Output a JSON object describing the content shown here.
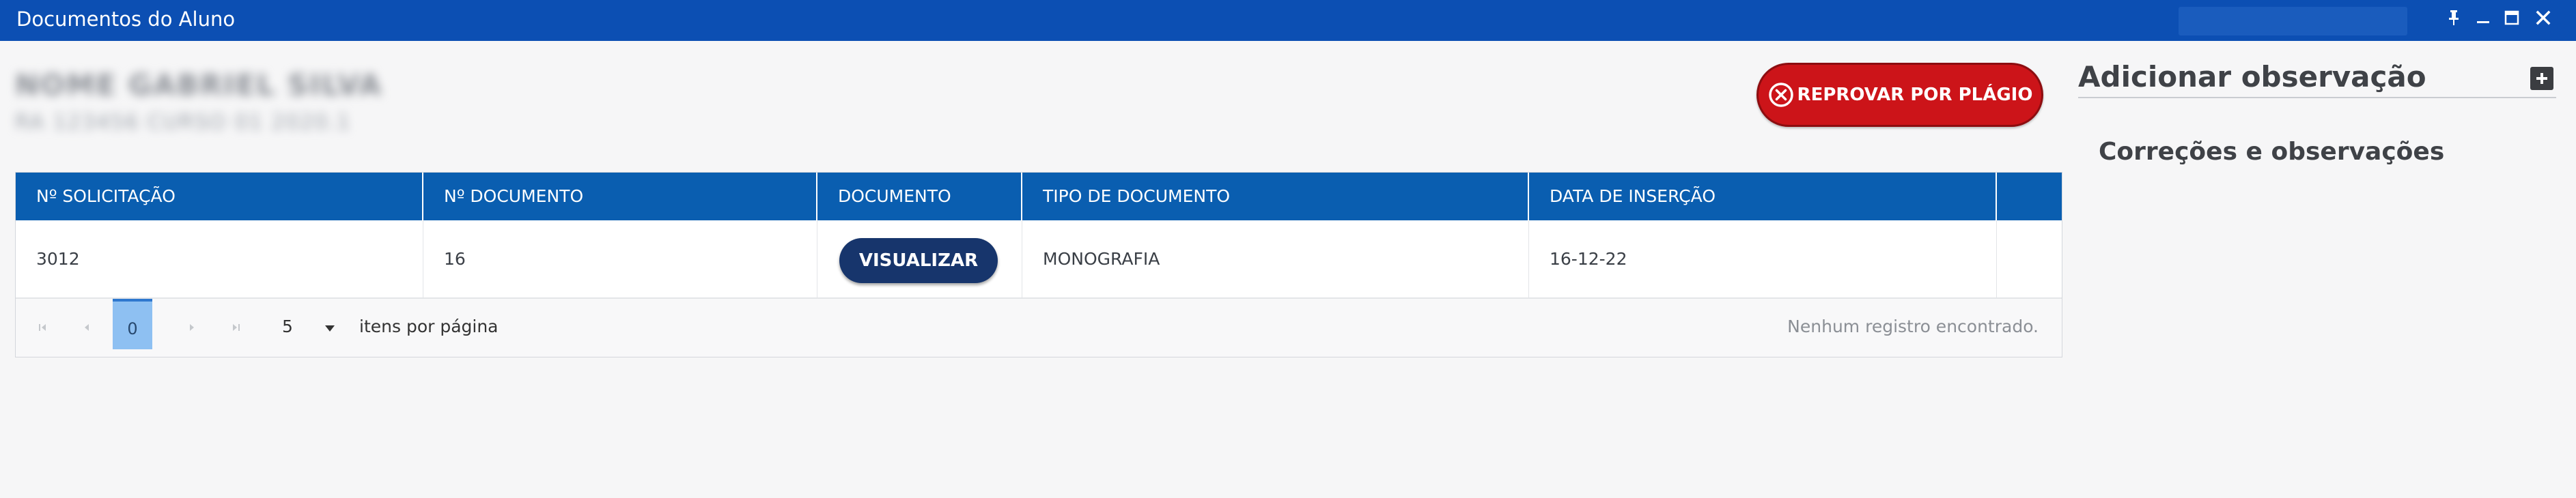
{
  "window": {
    "title": "Documentos do Aluno"
  },
  "student": {
    "name": "NOME GABRIEL SILVA",
    "details": "RA 123456 CURSO 01 2020.1"
  },
  "actions": {
    "reject_label": "REPROVAR POR PLÁGIO"
  },
  "table": {
    "columns": [
      "Nº SOLICITAÇÃO",
      "Nº DOCUMENTO",
      "DOCUMENTO",
      "TIPO DE DOCUMENTO",
      "DATA DE INSERÇÃO"
    ],
    "rows": [
      {
        "solicitacao": "3012",
        "documento_num": "16",
        "view_label": "VISUALIZAR",
        "tipo": "MONOGRAFIA",
        "data": "16-12-22"
      }
    ]
  },
  "paginator": {
    "current_page": "0",
    "page_size": "5",
    "page_size_label": "itens por página",
    "empty_message": "Nenhum registro encontrado."
  },
  "side_panel": {
    "title": "Adicionar observação",
    "subtitle": "Correções e observações"
  },
  "colors": {
    "titlebar": "#0c4fb3",
    "table_header": "#0a5eb0",
    "reject": "#cc1419",
    "view_button": "#17356c",
    "current_page": "#8ec0f2"
  }
}
